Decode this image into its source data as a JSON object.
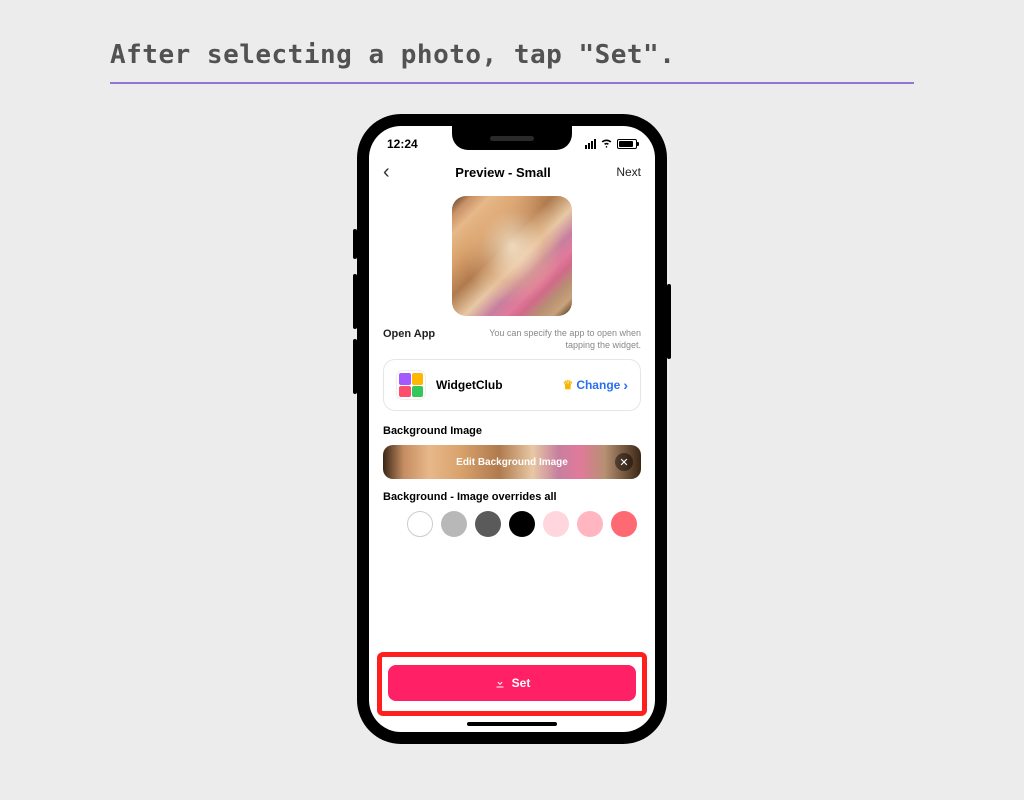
{
  "instruction": "After selecting a photo, tap \"Set\".",
  "status": {
    "time": "12:24"
  },
  "nav": {
    "title": "Preview - Small",
    "next": "Next"
  },
  "openApp": {
    "label": "Open App",
    "hint": "You can specify the app to open when tapping the widget.",
    "appName": "WidgetClub",
    "changeLabel": "Change"
  },
  "bgImage": {
    "label": "Background Image",
    "bannerText": "Edit Background Image"
  },
  "bgColor": {
    "label": "Background - Image overrides all",
    "swatches": [
      "#ffffff",
      "#b8b8b8",
      "#5a5a5a",
      "#000000",
      "#ffd6de",
      "#ffb6c1",
      "#ff6973"
    ]
  },
  "setButton": {
    "label": "Set"
  }
}
